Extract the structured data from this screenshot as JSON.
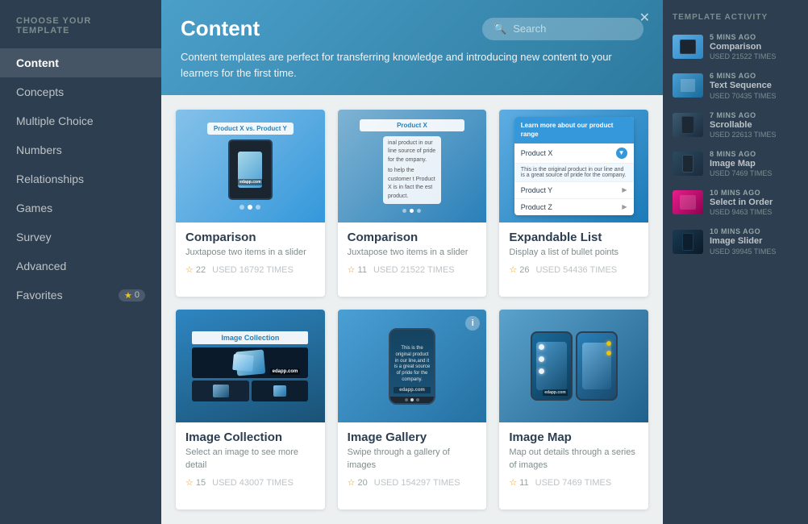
{
  "sidebar": {
    "title": "CHOOSE YOUR TEMPLATE",
    "items": [
      {
        "id": "content",
        "label": "Content",
        "active": true
      },
      {
        "id": "concepts",
        "label": "Concepts",
        "active": false
      },
      {
        "id": "multiple-choice",
        "label": "Multiple Choice",
        "active": false
      },
      {
        "id": "numbers",
        "label": "Numbers",
        "active": false
      },
      {
        "id": "relationships",
        "label": "Relationships",
        "active": false
      },
      {
        "id": "games",
        "label": "Games",
        "active": false
      },
      {
        "id": "survey",
        "label": "Survey",
        "active": false
      },
      {
        "id": "advanced",
        "label": "Advanced",
        "active": false
      },
      {
        "id": "favorites",
        "label": "Favorites",
        "active": false,
        "badge": "0"
      }
    ]
  },
  "main": {
    "title": "Content",
    "subtitle": "Content templates are perfect for transferring knowledge and introducing new content to your learners for the first time.",
    "search_placeholder": "Search",
    "templates": [
      {
        "id": "comparison-1",
        "name": "Comparison",
        "desc": "Juxtapose two items in a slider",
        "stars": 22,
        "used": "USED 16792 TIMES",
        "preview_type": "comparison1",
        "preview_label": "Product X vs. Product Y"
      },
      {
        "id": "comparison-2",
        "name": "Comparison",
        "desc": "Juxtapose two items in a slider",
        "stars": 11,
        "used": "USED 21522 TIMES",
        "preview_type": "comparison2",
        "preview_label": "Product X"
      },
      {
        "id": "expandable-list",
        "name": "Expandable List",
        "desc": "Display a list of bullet points",
        "stars": 26,
        "used": "USED 54436 TIMES",
        "preview_type": "expandable",
        "header_label": "Learn more about our product range",
        "rows": [
          "Product X",
          "Product Y",
          "Product Z"
        ]
      },
      {
        "id": "image-collection",
        "name": "Image Collection",
        "desc": "Select an image to see more detail",
        "stars": 15,
        "used": "USED 43007 TIMES",
        "preview_type": "image-collection",
        "preview_title": "Image Collection"
      },
      {
        "id": "image-gallery",
        "name": "Image Gallery",
        "desc": "Swipe through a gallery of images",
        "stars": 20,
        "used": "USED 154297 TIMES",
        "preview_type": "image-gallery"
      },
      {
        "id": "image-map",
        "name": "Image Map",
        "desc": "Map out details through a series of images",
        "stars": 11,
        "used": "USED 7469 TIMES",
        "preview_type": "image-map"
      }
    ]
  },
  "activity": {
    "title": "TEMPLATE ACTIVITY",
    "items": [
      {
        "time": "5 MINS AGO",
        "name": "Comparison",
        "used": "USED 21522 TIMES",
        "thumb": "blue"
      },
      {
        "time": "6 MINS AGO",
        "name": "Text Sequence",
        "used": "USED 70435 TIMES",
        "thumb": "blue"
      },
      {
        "time": "7 MINS AGO",
        "name": "Scrollable",
        "used": "USED 22613 TIMES",
        "thumb": "dark"
      },
      {
        "time": "8 MINS AGO",
        "name": "Image Map",
        "used": "USED 7469 TIMES",
        "thumb": "dark"
      },
      {
        "time": "10 MINS AGO",
        "name": "Select in Order",
        "used": "USED 9463 TIMES",
        "thumb": "pink"
      },
      {
        "time": "10 MINS AGO",
        "name": "Image Slider",
        "used": "USED 39945 TIMES",
        "thumb": "navy"
      }
    ]
  }
}
